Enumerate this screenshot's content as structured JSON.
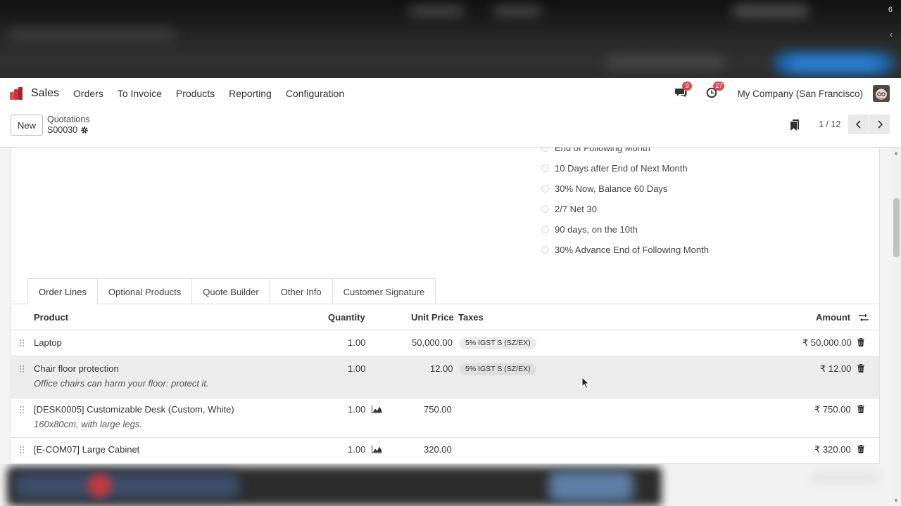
{
  "top_band": {
    "number": "6",
    "chevron": "‹"
  },
  "navbar": {
    "app_name": "Sales",
    "menu": [
      "Orders",
      "To Invoice",
      "Products",
      "Reporting",
      "Configuration"
    ],
    "messages_badge": "9",
    "activities_badge": "27",
    "company": "My Company (San Francisco)",
    "colors": {
      "logo_red": "#e4474f",
      "logo_dark": "#c0392b",
      "badge": "#e4474f"
    }
  },
  "control_panel": {
    "new_label": "New",
    "breadcrumb_parent": "Quotations",
    "record_name": "S00030",
    "pager_value": "1 / 12"
  },
  "payment_terms_options": [
    "End of Following Month",
    "10 Days after End of Next Month",
    "30% Now, Balance 60 Days",
    "2/7 Net 30",
    "90 days, on the 10th",
    "30% Advance End of Following Month"
  ],
  "tabs": [
    "Order Lines",
    "Optional Products",
    "Quote Builder",
    "Other Info",
    "Customer Signature"
  ],
  "active_tab": "Order Lines",
  "table": {
    "headers": {
      "product": "Product",
      "quantity": "Quantity",
      "unit_price": "Unit Price",
      "taxes": "Taxes",
      "amount": "Amount"
    },
    "rows": [
      {
        "product": "Laptop",
        "description": "",
        "quantity": "1.00",
        "unit_price": "50,000.00",
        "tax": "5% IGST S (SZ/EX)",
        "amount": "₹ 50,000.00",
        "forecast": false
      },
      {
        "product": "Chair floor protection",
        "description": "Office chairs can harm your floor: protect it.",
        "quantity": "1.00",
        "unit_price": "12.00",
        "tax": "5% IGST S (SZ/EX)",
        "amount": "₹ 12.00",
        "forecast": false
      },
      {
        "product": "[DESK0005] Customizable Desk (Custom, White)",
        "description": "160x80cm, with large legs.",
        "quantity": "1.00",
        "unit_price": "750.00",
        "tax": "",
        "amount": "₹ 750.00",
        "forecast": true
      },
      {
        "product": "[E-COM07] Large Cabinet",
        "description": "",
        "quantity": "1.00",
        "unit_price": "320.00",
        "tax": "",
        "amount": "₹ 320.00",
        "forecast": true
      }
    ]
  }
}
